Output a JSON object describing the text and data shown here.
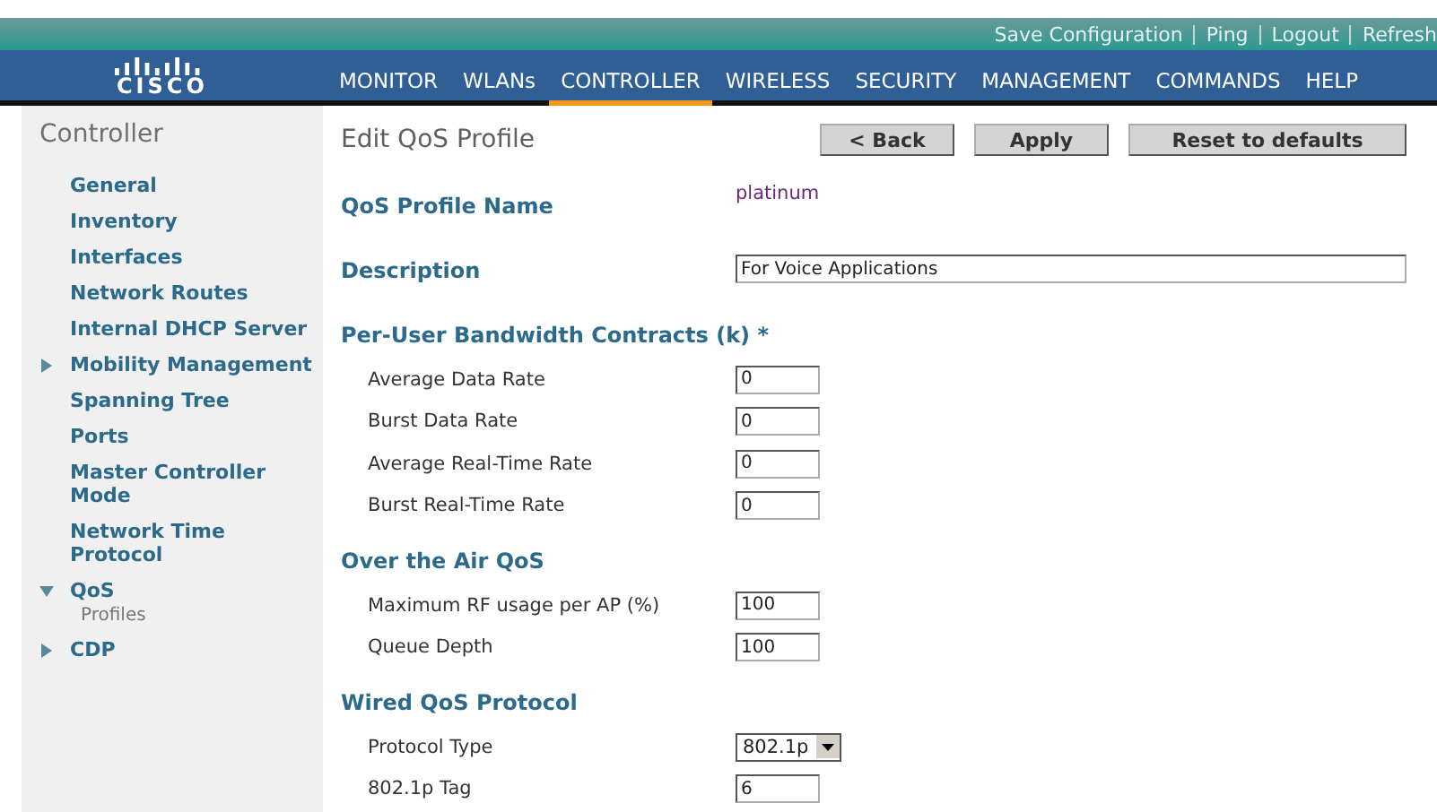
{
  "header": {
    "logo": "CISCO",
    "links": [
      "Save Configuration",
      "Ping",
      "Logout",
      "Refresh"
    ],
    "nav": [
      {
        "label": "MONITOR",
        "selected": false
      },
      {
        "label": "WLANs",
        "selected": false
      },
      {
        "label": "CONTROLLER",
        "selected": true
      },
      {
        "label": "WIRELESS",
        "selected": false
      },
      {
        "label": "SECURITY",
        "selected": false
      },
      {
        "label": "MANAGEMENT",
        "selected": false
      },
      {
        "label": "COMMANDS",
        "selected": false
      },
      {
        "label": "HELP",
        "selected": false
      }
    ]
  },
  "sidebar": {
    "title": "Controller",
    "items": [
      {
        "label": "General",
        "kind": "link"
      },
      {
        "label": "Inventory",
        "kind": "link"
      },
      {
        "label": "Interfaces",
        "kind": "link"
      },
      {
        "label": "Network Routes",
        "kind": "link"
      },
      {
        "label": "Internal DHCP Server",
        "kind": "link"
      },
      {
        "label": "Mobility Management",
        "kind": "folder",
        "expanded": false
      },
      {
        "label": "Spanning Tree",
        "kind": "link"
      },
      {
        "label": "Ports",
        "kind": "link"
      },
      {
        "label": "Master Controller Mode",
        "kind": "link"
      },
      {
        "label": "Network Time Protocol",
        "kind": "link"
      },
      {
        "label": "QoS",
        "kind": "folder",
        "expanded": true,
        "children": [
          {
            "label": "Profiles"
          }
        ]
      },
      {
        "label": "CDP",
        "kind": "folder",
        "expanded": false
      }
    ]
  },
  "page": {
    "title": "Edit QoS Profile",
    "buttons": [
      "< Back",
      "Apply",
      "Reset to defaults"
    ]
  },
  "top_fields": [
    {
      "label": "QoS Profile Name",
      "kind": "text",
      "value": "platinum"
    },
    {
      "label": "Description",
      "kind": "wide",
      "value": "For Voice Applications"
    }
  ],
  "sections": [
    {
      "title": "Per-User Bandwidth Contracts (k) *",
      "rows": [
        {
          "label": "Average Data Rate",
          "kind": "input",
          "value": "0"
        },
        {
          "label": "Burst Data Rate",
          "kind": "input",
          "value": "0"
        },
        {
          "label": "Average Real-Time Rate",
          "kind": "input",
          "value": "0"
        },
        {
          "label": "Burst Real-Time Rate",
          "kind": "input",
          "value": "0"
        }
      ]
    },
    {
      "title": "Over the Air QoS",
      "rows": [
        {
          "label": "Maximum RF usage per AP (%)",
          "kind": "input",
          "value": "100"
        },
        {
          "label": "Queue Depth",
          "kind": "input",
          "value": "100"
        }
      ]
    },
    {
      "title": "Wired QoS Protocol",
      "rows": [
        {
          "label": "Protocol Type",
          "kind": "select",
          "value": "802.1p"
        },
        {
          "label": "802.1p Tag",
          "kind": "input",
          "value": "6"
        }
      ]
    }
  ]
}
